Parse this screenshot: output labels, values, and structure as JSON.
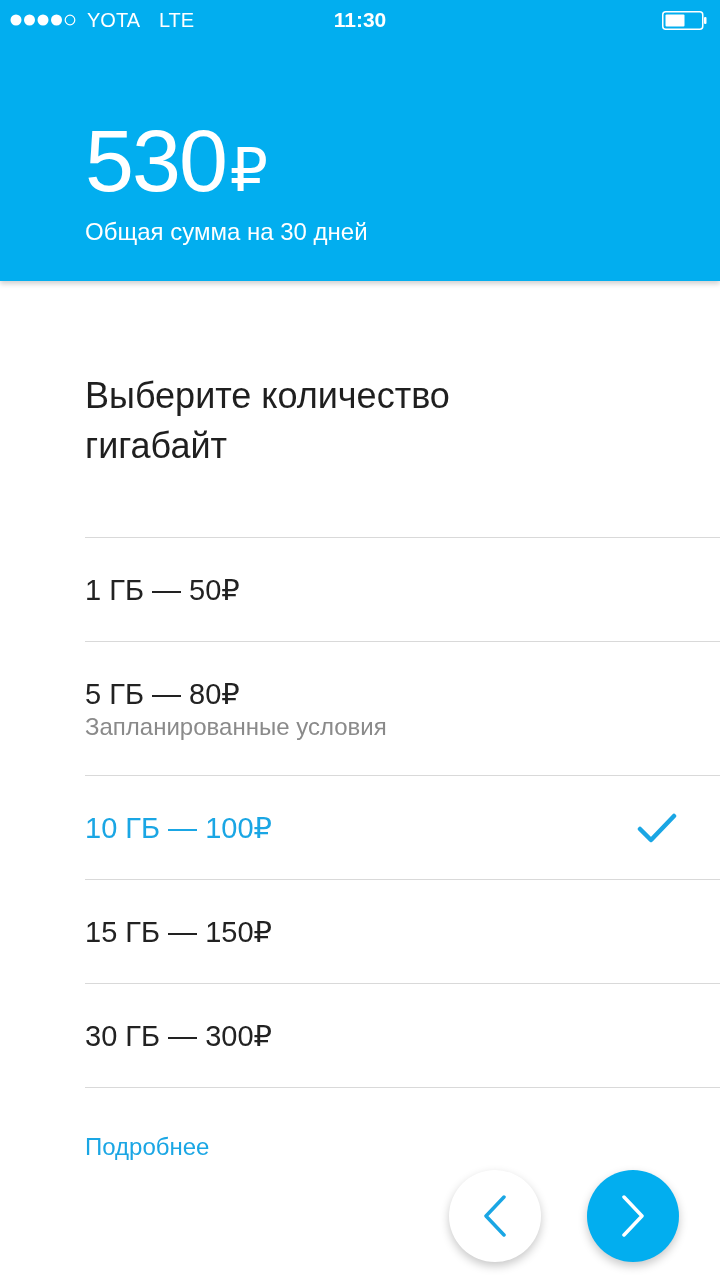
{
  "status_bar": {
    "carrier": "YOTA",
    "network": "LTE",
    "time": "11:30"
  },
  "summary": {
    "amount": "530",
    "currency": "₽",
    "caption": "Общая сумма на 30 дней"
  },
  "title": "Выберите количество гигабайт",
  "options": [
    {
      "label": "1 ГБ — 50₽",
      "selected": false
    },
    {
      "label": "5 ГБ — 80₽",
      "note": "Запланированные условия",
      "selected": false
    },
    {
      "label": "10 ГБ — 100₽",
      "selected": true
    },
    {
      "label": "15 ГБ — 150₽",
      "selected": false
    },
    {
      "label": "30 ГБ — 300₽",
      "selected": false
    }
  ],
  "more_link": "Подробнее"
}
